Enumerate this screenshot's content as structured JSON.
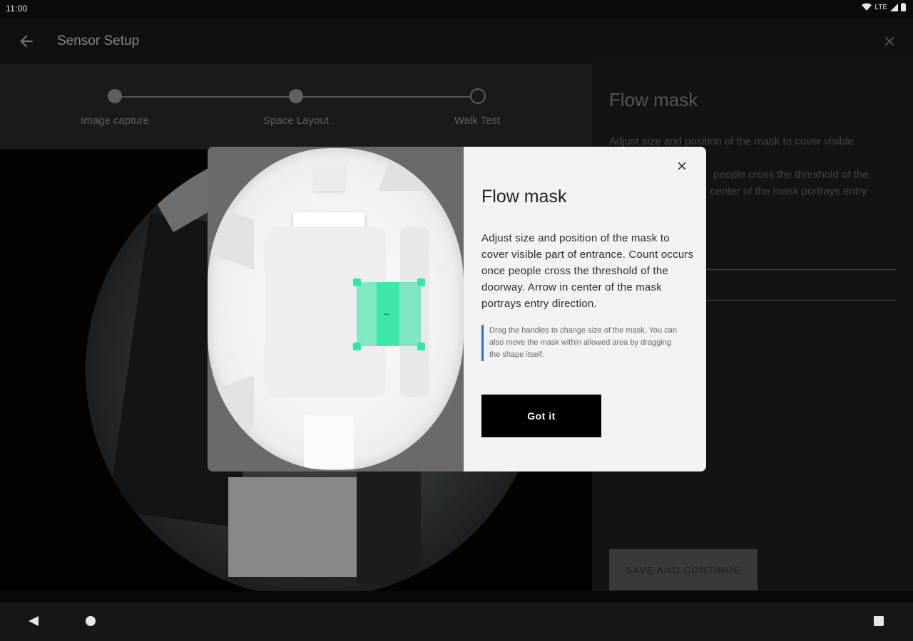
{
  "status_bar": {
    "time": "11:00",
    "network": "LTE"
  },
  "app_bar": {
    "title": "Sensor Setup"
  },
  "stepper": {
    "steps": [
      {
        "label": "Image capture"
      },
      {
        "label": "Space Layout"
      },
      {
        "label": "Walk Test"
      }
    ]
  },
  "side_panel": {
    "title": "Flow mask",
    "line1": "Adjust size and position of the mask to cover visible",
    "line2": "people cross the threshold of the",
    "line3": "center of the mask portrays entry",
    "save_label": "SAVE AND CONTINUE"
  },
  "dialog": {
    "title": "Flow mask",
    "body": "Adjust size and position of the mask to cover visible part of entrance. Count occurs once people cross the threshold of the doorway. Arrow in center of the mask portrays entry direction.",
    "note": "Drag the handles to change size of the mask. You can also move the mask within allowed area by dragging the shape itself.",
    "button_label": "Got it",
    "mask_arrow": "←"
  },
  "colors": {
    "mask": "#34e6a6",
    "note_border": "#2a6fd1",
    "button": "#000000"
  },
  "icons": [
    "back-arrow-icon",
    "close-icon",
    "wifi-icon",
    "signal-icon",
    "battery-icon",
    "nav-back-icon",
    "nav-home-icon",
    "nav-recents-icon"
  ]
}
